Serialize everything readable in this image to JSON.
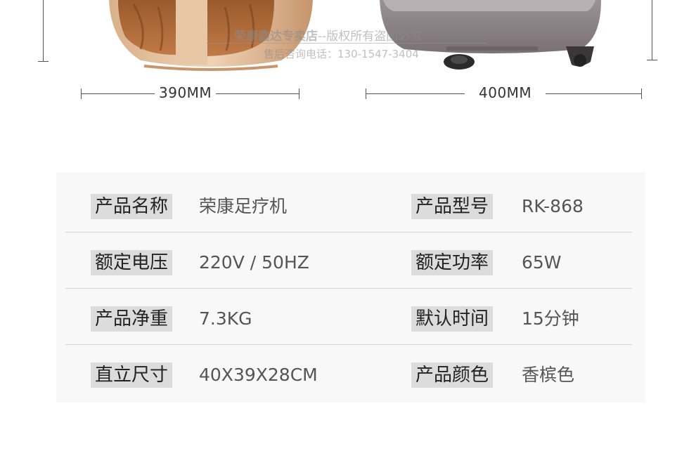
{
  "dimensions": {
    "left": "390MM",
    "right": "400MM"
  },
  "watermark": {
    "line1_bold": "荣康鑫达专卖店",
    "line1_rest": "--版权所有盗图必究",
    "line2": "售后咨询电话：130-1547-3404"
  },
  "colors": {
    "panel_bg": "#f8f8f8",
    "label_bg": "#dcdcdc",
    "divider": "#d4d4d4",
    "massager_left": "#c9956a",
    "massager_right": "#8a7f82"
  },
  "specs": [
    {
      "label_l": "产品名称",
      "value_l": "荣康足疗机",
      "label_r": "产品型号",
      "value_r": "RK-868"
    },
    {
      "label_l": "额定电压",
      "value_l": "220V / 50HZ",
      "label_r": "额定功率",
      "value_r": "65W"
    },
    {
      "label_l": "产品净重",
      "value_l": "7.3KG",
      "label_r": "默认时间",
      "value_r": "15分钟"
    },
    {
      "label_l": "直立尺寸",
      "value_l": "40X39X28CM",
      "label_r": "产品颜色",
      "value_r": "香槟色"
    }
  ]
}
